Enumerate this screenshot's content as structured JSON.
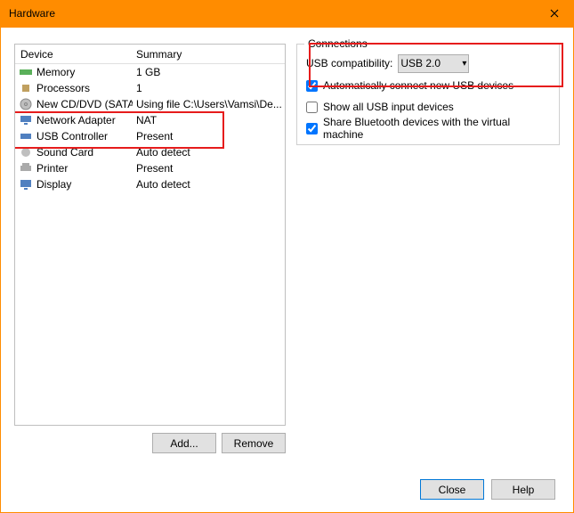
{
  "window": {
    "title": "Hardware"
  },
  "left": {
    "headers": {
      "device": "Device",
      "summary": "Summary"
    },
    "rows": [
      {
        "name": "Memory",
        "summary": "1 GB"
      },
      {
        "name": "Processors",
        "summary": "1"
      },
      {
        "name": "New CD/DVD (SATA)",
        "summary": "Using file C:\\Users\\Vamsi\\De..."
      },
      {
        "name": "Network Adapter",
        "summary": "NAT"
      },
      {
        "name": "USB Controller",
        "summary": "Present"
      },
      {
        "name": "Sound Card",
        "summary": "Auto detect"
      },
      {
        "name": "Printer",
        "summary": "Present"
      },
      {
        "name": "Display",
        "summary": "Auto detect"
      }
    ],
    "buttons": {
      "add": "Add...",
      "remove": "Remove"
    }
  },
  "right": {
    "group": "Connections",
    "usb_compat_label": "USB compatibility:",
    "usb_compat_value": "USB 2.0",
    "checks": {
      "auto_connect": "Automatically connect new USB devices",
      "show_all": "Show all USB input devices",
      "share_bt": "Share Bluetooth devices with the virtual machine"
    }
  },
  "bottom": {
    "close": "Close",
    "help": "Help"
  }
}
